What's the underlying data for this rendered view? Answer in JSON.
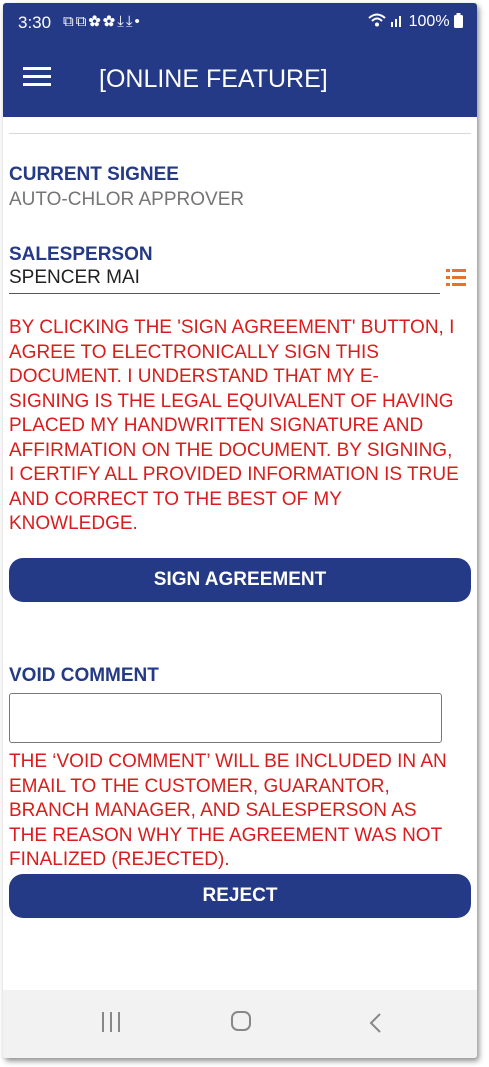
{
  "status_bar": {
    "time": "3:30",
    "status_icons": "⧉⧉✿✿⤓⤓•",
    "battery_text": "100%"
  },
  "app_bar": {
    "title": "[ONLINE FEATURE]",
    "menu_icon": "hamburger-menu-icon"
  },
  "current_signee": {
    "label": "CURRENT SIGNEE",
    "value": "AUTO-CHLOR APPROVER"
  },
  "salesperson": {
    "label": "SALESPERSON",
    "value": "SPENCER MAI",
    "list_icon": "list-icon",
    "list_icon_color": "#e8712b"
  },
  "sign_disclaimer": [
    "BY CLICKING THE 'SIGN AGREEMENT' BUTTON, I",
    "AGREE TO ELECTRONICALLY SIGN THIS",
    "DOCUMENT. I UNDERSTAND THAT MY E-",
    "SIGNING IS THE LEGAL EQUIVALENT OF HAVING",
    "PLACED MY HANDWRITTEN SIGNATURE AND",
    "AFFIRMATION ON THE DOCUMENT. BY SIGNING,",
    "I CERTIFY ALL PROVIDED INFORMATION IS TRUE",
    "AND CORRECT TO THE BEST OF MY",
    "KNOWLEDGE."
  ],
  "sign_button": {
    "label": "SIGN AGREEMENT"
  },
  "void_comment": {
    "label": "VOID COMMENT",
    "value": "",
    "note": [
      "THE ‘VOID COMMENT’ WILL BE INCLUDED IN AN",
      "EMAIL TO THE CUSTOMER, GUARANTOR,",
      "BRANCH MANAGER, AND SALESPERSON AS",
      "THE REASON WHY THE AGREEMENT WAS NOT",
      "FINALIZED (REJECTED)."
    ]
  },
  "reject_button": {
    "label": "REJECT"
  },
  "colors": {
    "primary": "#253a86",
    "warning": "#d91c1c",
    "muted": "#757575",
    "accent": "#e8712b"
  },
  "nav_bar": {
    "recent_icon": "recent-apps-icon",
    "home_icon": "home-icon",
    "back_icon": "back-icon"
  }
}
